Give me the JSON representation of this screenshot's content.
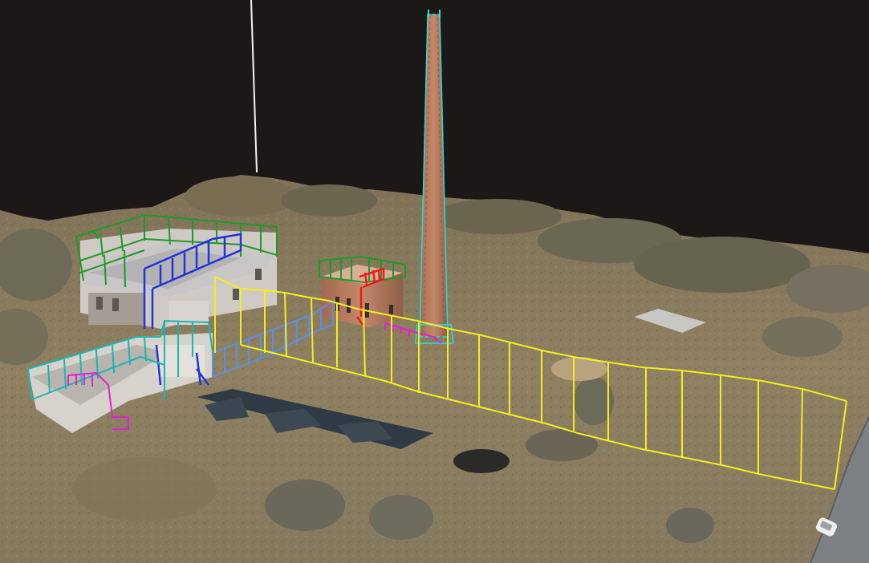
{
  "scene": {
    "kind": "3d-point-cloud-viewer",
    "description_icon": "point-cloud-icon",
    "colors": {
      "background": "#1b1817",
      "terrain_base": "#8a7a5e",
      "vegetation": "#6e6a55",
      "brick": "#b87a5a",
      "roof_panel": "#c9c6c8",
      "wall": "#d8d4cf",
      "fence_yellow": "#f2ee22",
      "annotation_green": "#1f9a2a",
      "annotation_blue": "#2233d8",
      "annotation_light_blue": "#5b8fe0",
      "annotation_teal": "#1fb4b0",
      "annotation_magenta": "#e61fd0",
      "annotation_red": "#ee1a1a",
      "annotation_cyan": "#22e0e0",
      "annotation_white": "#f4f4f4",
      "pavement": "#2f3a44",
      "road": "#7d8084"
    },
    "annotation_layers": [
      "green-roof-railing",
      "blue-stair-railing",
      "light-blue-fence",
      "teal-fence",
      "magenta-fence",
      "red-stair",
      "chimney-outline",
      "yellow-perimeter-fence",
      "white-vertical-marker"
    ]
  }
}
